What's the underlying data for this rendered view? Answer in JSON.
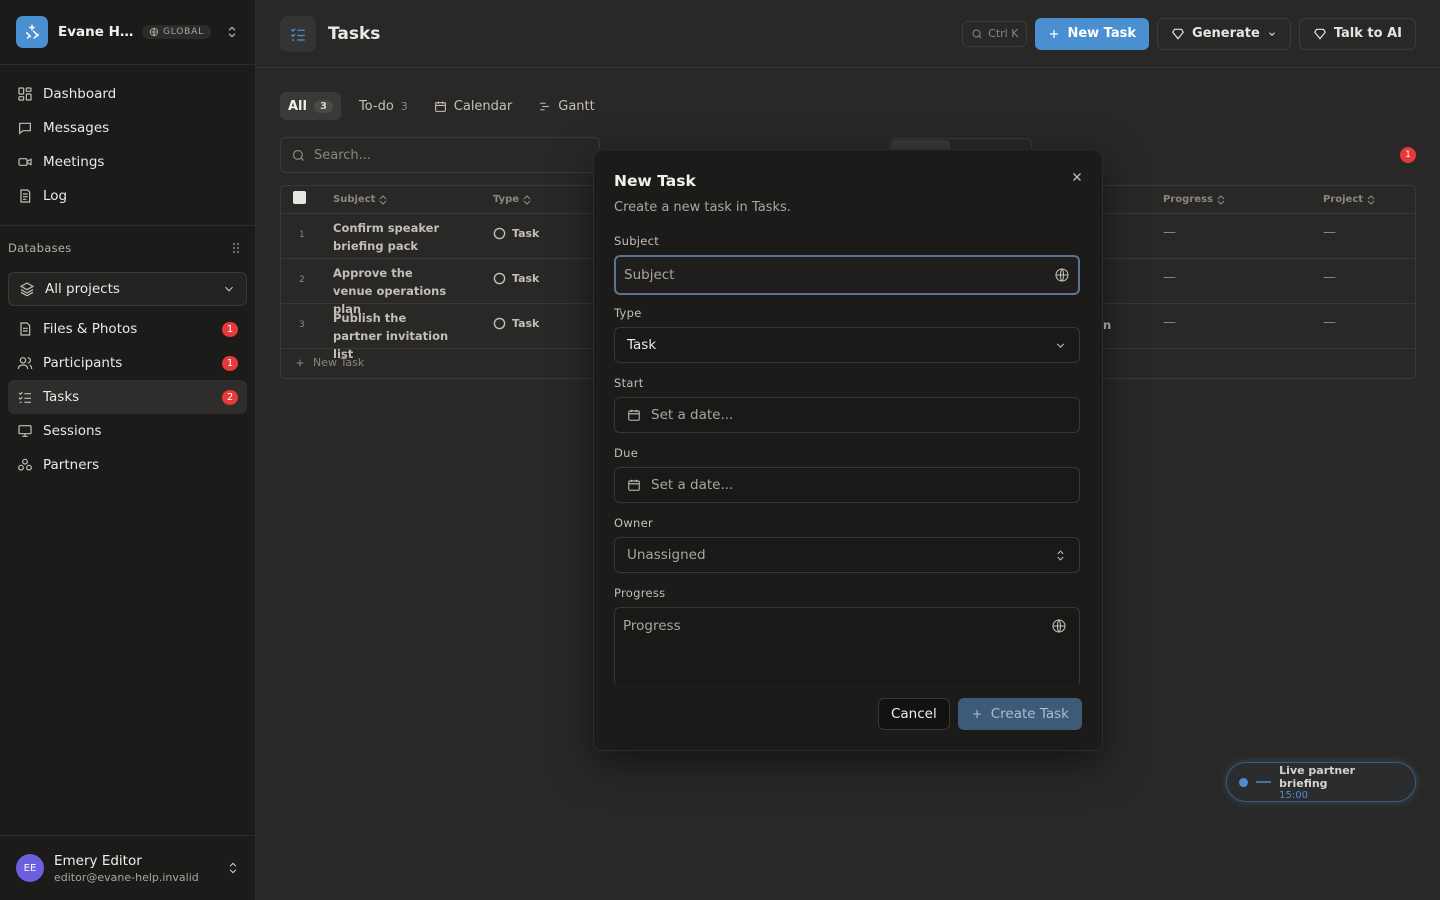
{
  "workspace": {
    "name": "Evane Help",
    "scope_badge": "GLOBAL"
  },
  "nav": [
    {
      "label": "Dashboard",
      "icon": "dashboard-icon"
    },
    {
      "label": "Messages",
      "icon": "messages-icon"
    },
    {
      "label": "Meetings",
      "icon": "video-icon"
    },
    {
      "label": "Log",
      "icon": "log-icon"
    }
  ],
  "databases": {
    "heading": "Databases",
    "project_select": "All projects",
    "items": [
      {
        "label": "Files & Photos",
        "badge": "1"
      },
      {
        "label": "Participants",
        "badge": "1"
      },
      {
        "label": "Tasks",
        "badge": "2",
        "active": true
      },
      {
        "label": "Sessions",
        "badge": ""
      },
      {
        "label": "Partners",
        "badge": ""
      }
    ]
  },
  "user": {
    "initials": "EE",
    "name": "Emery Editor",
    "email": "editor@evane-help.invalid"
  },
  "page": {
    "title": "Tasks",
    "shortcut": "Ctrl K",
    "new_task": "New Task",
    "generate": "Generate",
    "talk_to_ai": "Talk to AI"
  },
  "tabs": [
    {
      "label": "All",
      "count": "3"
    },
    {
      "label": "To-do",
      "count": "3"
    },
    {
      "label": "Calendar"
    },
    {
      "label": "Gantt"
    }
  ],
  "search_placeholder": "Search...",
  "alert_count": "1",
  "table": {
    "columns": [
      "Subject",
      "Type",
      "Progress",
      "Project"
    ],
    "rows": [
      {
        "num": "1",
        "subject": "Confirm speaker briefing pack",
        "type": "Task",
        "trail": "",
        "progress": "—",
        "project": "—"
      },
      {
        "num": "2",
        "subject": "Approve the venue operations plan",
        "type": "Task",
        "trail": "",
        "progress": "—",
        "project": "—"
      },
      {
        "num": "3",
        "subject": "Publish the partner invitation list",
        "type": "Task",
        "trail": "n",
        "progress": "—",
        "project": "—"
      }
    ],
    "new_row": "New Task"
  },
  "toast": {
    "title": "Live partner briefing",
    "time": "15:00"
  },
  "modal": {
    "title": "New Task",
    "description": "Create a new task in Tasks.",
    "subject_label": "Subject",
    "subject_placeholder": "Subject",
    "type_label": "Type",
    "type_value": "Task",
    "start_label": "Start",
    "start_placeholder": "Set a date...",
    "due_label": "Due",
    "due_placeholder": "Set a date...",
    "owner_label": "Owner",
    "owner_value": "Unassigned",
    "progress_label": "Progress",
    "progress_placeholder": "Progress",
    "cancel": "Cancel",
    "create": "Create Task"
  },
  "colors": {
    "accent": "#4a8fd0",
    "badge": "#e5393b",
    "avatar": "#6b5fe0"
  }
}
